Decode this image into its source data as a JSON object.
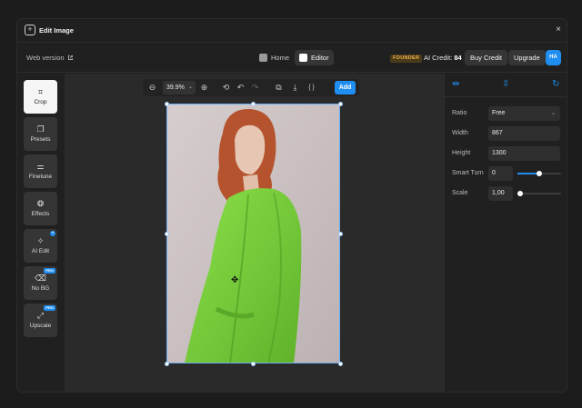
{
  "window": {
    "title": "Edit Image",
    "close_glyph": "×"
  },
  "topbar": {
    "web_version": "Web version",
    "nav": {
      "home": "Home",
      "editor": "Editor"
    },
    "founder_badge": "FOUNDER",
    "ai_credit_label": "AI Credit:",
    "ai_credit_value": "84",
    "buy_credit": "Buy Credit",
    "upgrade": "Upgrade",
    "avatar_initials": "HA"
  },
  "tools": [
    {
      "label": "Crop",
      "icon": "crop-icon",
      "glyph": "⌗",
      "active": true
    },
    {
      "label": "Presets",
      "icon": "presets-icon",
      "glyph": "❐"
    },
    {
      "label": "Finetune",
      "icon": "finetune-icon",
      "glyph": "⚌"
    },
    {
      "label": "Effects",
      "icon": "effects-icon",
      "glyph": "❂"
    },
    {
      "label": "AI Edit",
      "icon": "ai-edit-icon",
      "glyph": "✧",
      "dot": "+"
    },
    {
      "label": "No BG",
      "icon": "eraser-icon",
      "glyph": "⌫",
      "badge": "PRO"
    },
    {
      "label": "Upscale",
      "icon": "upscale-icon",
      "glyph": "⤢",
      "badge": "PRO"
    }
  ],
  "toolbar": {
    "zoom": "39.9%",
    "zoom_chevron": "⌄",
    "add": "Add",
    "icons": {
      "zoom_out": "⊖",
      "zoom_in": "⊕",
      "history": "⟲",
      "undo": "↶",
      "redo": "↷",
      "copy": "⧉",
      "download": "⤓",
      "code": "{ }"
    }
  },
  "right_panel": {
    "tab_icons": {
      "flip_horizontal": "⇹",
      "flip_vertical": "⇳",
      "rotate": "↻"
    },
    "ratio_label": "Ratio",
    "ratio_value": "Free",
    "width_label": "Width",
    "width_value": "867",
    "height_label": "Height",
    "height_value": "1300",
    "smart_turn_label": "Smart Turn",
    "smart_turn_value": "0",
    "smart_turn_level": 0.5,
    "scale_label": "Scale",
    "scale_value": "1,00",
    "scale_level": 0.0
  },
  "colors": {
    "accent": "#1f8ef0",
    "photo_bg": "#c9bebf",
    "coat": "#7cd03d",
    "hair": "#b5532f"
  },
  "canvas": {
    "move_icon": "✥"
  }
}
